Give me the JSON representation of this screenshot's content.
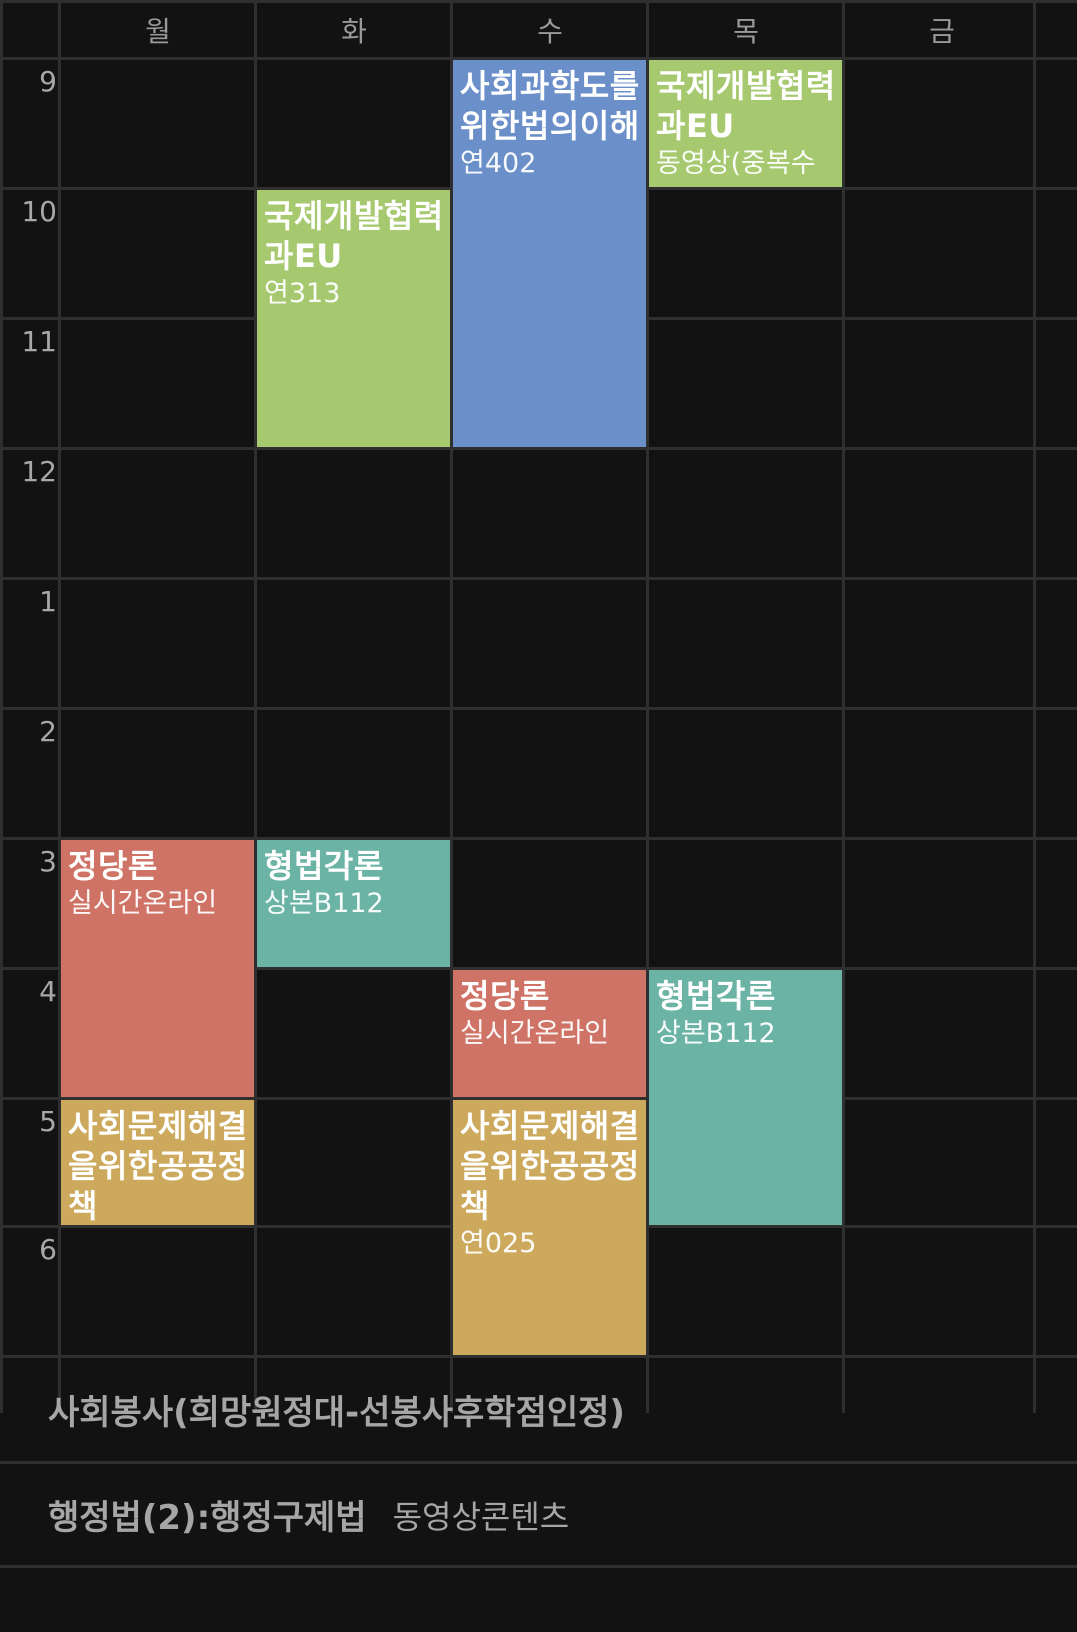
{
  "days": [
    "월",
    "화",
    "수",
    "목",
    "금"
  ],
  "hours": [
    "9",
    "10",
    "11",
    "12",
    "1",
    "2",
    "3",
    "4",
    "5",
    "6"
  ],
  "colors": {
    "background": "#121212",
    "grid": "#2f2f2f",
    "green": "#a6c970",
    "blue": "#6b8fc9",
    "red": "#cf7366",
    "teal": "#6ab3a5",
    "gold": "#cca95c"
  },
  "courses": [
    {
      "id": "c1",
      "name": "사회과학도를위한법의이해",
      "room": "연402"
    },
    {
      "id": "c2",
      "name": "국제개발협력과EU",
      "room": "동영상(중복수"
    },
    {
      "id": "c3",
      "name": "국제개발협력과EU",
      "room": "연313"
    },
    {
      "id": "c4",
      "name": "정당론",
      "room": "실시간온라인"
    },
    {
      "id": "c5",
      "name": "형법각론",
      "room": "상본B112"
    },
    {
      "id": "c6",
      "name": "정당론",
      "room": "실시간온라인"
    },
    {
      "id": "c7",
      "name": "형법각론",
      "room": "상본B112"
    },
    {
      "id": "c8",
      "name": "사회문제해결을위한공공정책",
      "room": ""
    },
    {
      "id": "c9",
      "name": "사회문제해결을위한공공정책",
      "room": "연025"
    }
  ],
  "extras": [
    {
      "name": "사회봉사(희망원정대-선봉사후학점인정)",
      "note": ""
    },
    {
      "name": "행정법(2):행정구제법",
      "note": "동영상콘텐츠"
    }
  ]
}
